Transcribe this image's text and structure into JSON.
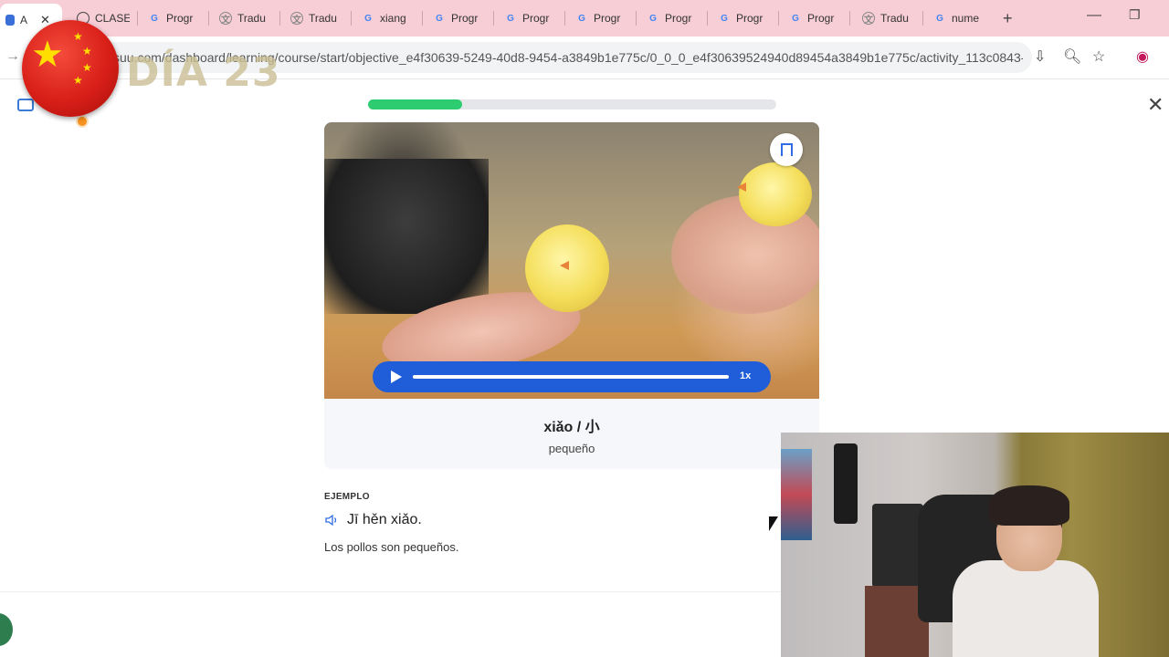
{
  "browser": {
    "tabs": [
      {
        "label": "A",
        "icon": "page-icon",
        "active": true
      },
      {
        "label": "CLASE",
        "icon": "openai-icon"
      },
      {
        "label": "Progr",
        "icon": "google-icon"
      },
      {
        "label": "Tradu",
        "icon": "translate-icon"
      },
      {
        "label": "Tradu",
        "icon": "translate-icon"
      },
      {
        "label": "xiang",
        "icon": "google-icon"
      },
      {
        "label": "Progr",
        "icon": "google-icon"
      },
      {
        "label": "Progr",
        "icon": "google-icon"
      },
      {
        "label": "Progr",
        "icon": "google-icon"
      },
      {
        "label": "Progr",
        "icon": "google-icon"
      },
      {
        "label": "Progr",
        "icon": "google-icon"
      },
      {
        "label": "Progr",
        "icon": "google-icon"
      },
      {
        "label": "Tradu",
        "icon": "translate-icon"
      },
      {
        "label": "nume",
        "icon": "google-icon"
      }
    ],
    "new_tab_symbol": "+",
    "url": "suu.com/dashboard/learning/course/start/objective_e4f30639-5249-40d8-9454-a3849b1e775c/0_0_0_e4f30639524940d89454a3849b1e775c/activity_113c0843-..."
  },
  "overlay": {
    "day_text": "DÍA 23",
    "flag_colors": {
      "red": "#de2910",
      "yellow": "#ffde00"
    }
  },
  "lesson": {
    "progress": 0.23,
    "progress_color": "#2ecc71",
    "word": "xiǎo / 小",
    "translation": "pequeño",
    "player": {
      "speed": "1x"
    },
    "example": {
      "label": "EJEMPLO",
      "pinyin": "Jī hěn xiǎo.",
      "translation": "Los pollos son pequeños."
    },
    "close_symbol": "✕"
  },
  "colors": {
    "accent": "#1f5ed8",
    "tab_bar": "#f7cdd6"
  }
}
